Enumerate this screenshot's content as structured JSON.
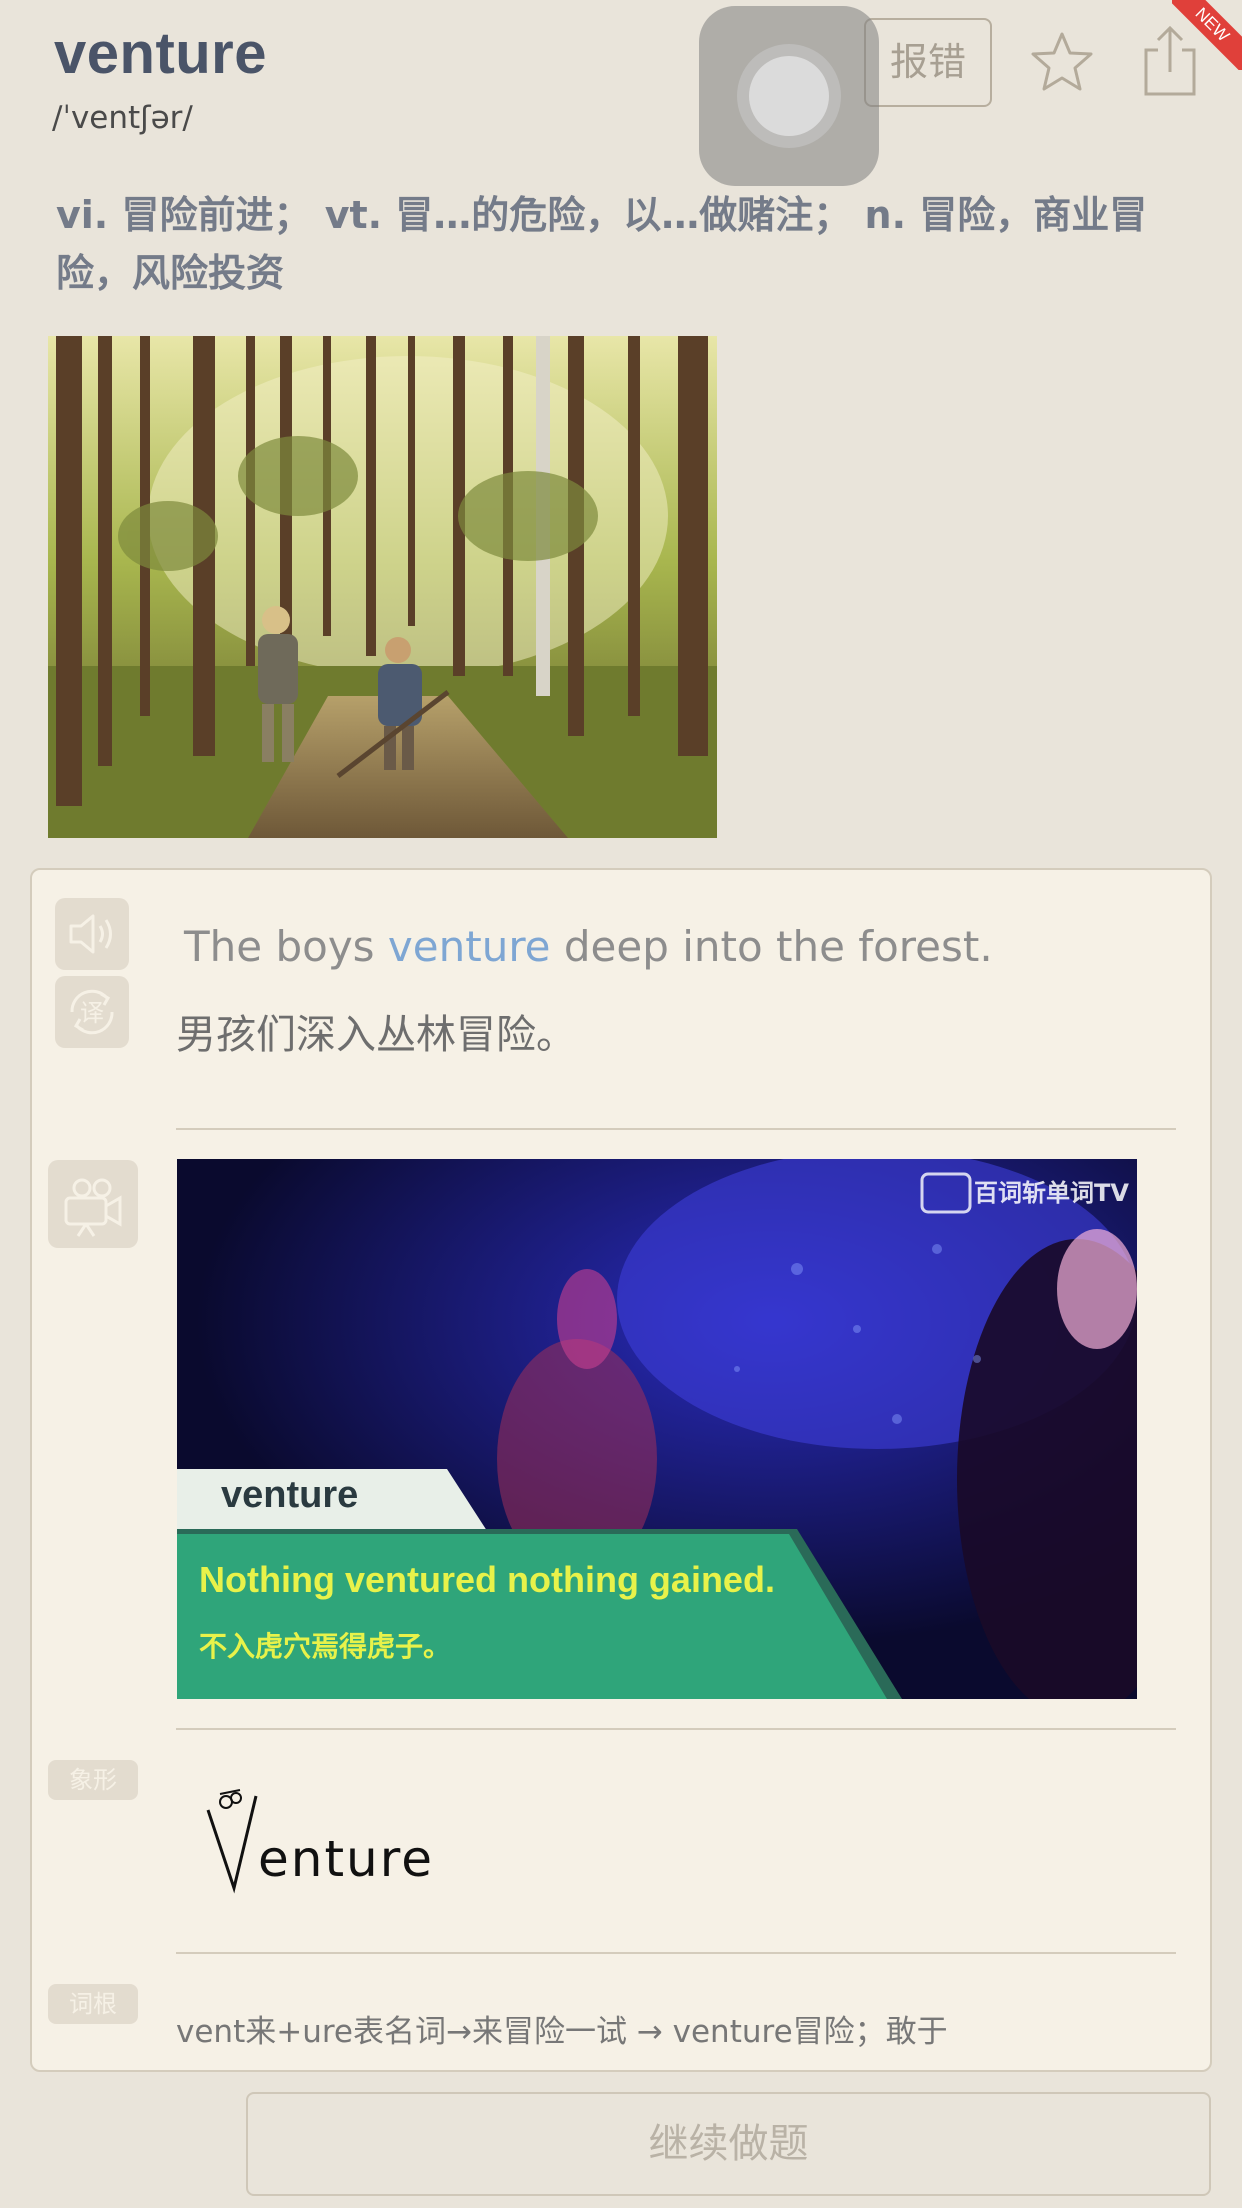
{
  "header": {
    "word": "venture",
    "phonetic": "/ˈventʃər/",
    "report_label": "报错",
    "new_badge": "NEW",
    "icons": [
      "star-icon",
      "share-icon"
    ]
  },
  "definition": "vi. 冒险前进；  vt. 冒…的危险，以…做赌注；  n. 冒险，商业冒险，风险投资",
  "example": {
    "en_before": "The boys ",
    "en_highlight": "venture",
    "en_after": " deep into the forest.",
    "zh": "男孩们深入丛林冒险。",
    "highlight_color": "#7ea6d3"
  },
  "video": {
    "channel": "百词斩单词TV",
    "word": "venture",
    "caption_en": "Nothing ventured nothing gained.",
    "caption_zh": "不入虎穴焉得虎子。",
    "caption_color": "#e8f24a",
    "band_color": "#2fa57a"
  },
  "pictograph": {
    "tag": "象形",
    "art_text": "enture"
  },
  "root": {
    "tag": "词根",
    "text": "vent来+ure表名词→来冒险一试 →  venture冒险；敢于"
  },
  "continue_label": "继续做题",
  "colors": {
    "background": "#e9e4da",
    "card": "#f6f1e6",
    "word": "#4a5468",
    "new_ribbon": "#e0403a"
  }
}
